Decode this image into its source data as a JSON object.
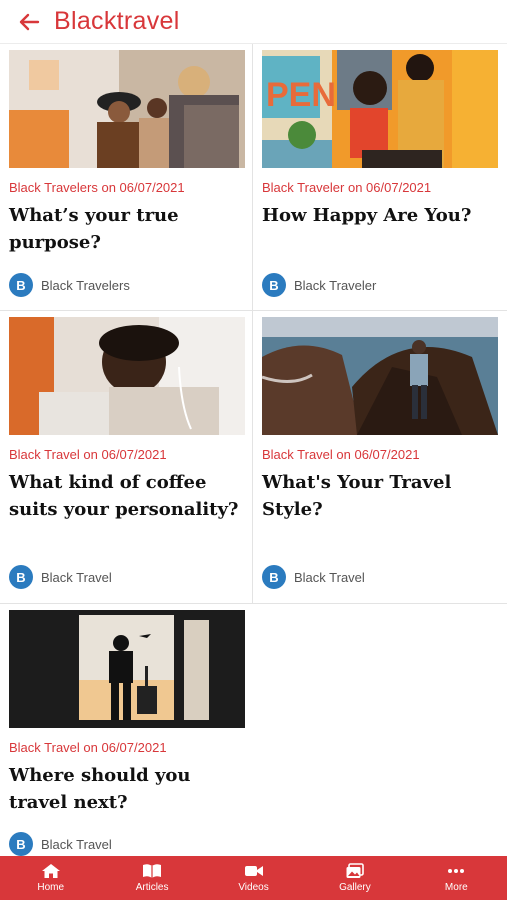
{
  "header": {
    "title": "Blacktravel",
    "back_icon": "arrow-left-icon"
  },
  "articles": [
    {
      "meta": "Black Travelers on 06/07/2021",
      "title": "What’s your true purpose?",
      "author_initial": "B",
      "author": "Black Travelers"
    },
    {
      "meta": "Black Traveler on 06/07/2021",
      "title": "How Happy Are You?",
      "author_initial": "B",
      "author": "Black Traveler"
    },
    {
      "meta": "Black Travel on 06/07/2021",
      "title": "What kind of coffee suits your personality?",
      "author_initial": "B",
      "author": "Black Travel"
    },
    {
      "meta": "Black Travel on 06/07/2021",
      "title": "What's Your Travel Style?",
      "author_initial": "B",
      "author": "Black Travel"
    },
    {
      "meta": "Black Travel on 06/07/2021",
      "title": "Where should you travel next?",
      "author_initial": "B",
      "author": "Black Travel"
    }
  ],
  "nav": [
    {
      "label": "Home",
      "icon": "home-icon"
    },
    {
      "label": "Articles",
      "icon": "book-icon"
    },
    {
      "label": "Videos",
      "icon": "video-camera-icon"
    },
    {
      "label": "Gallery",
      "icon": "gallery-icon"
    },
    {
      "label": "More",
      "icon": "more-dots-icon"
    }
  ],
  "colors": {
    "brand": "#d8373a",
    "badge": "#2b7bbf"
  }
}
